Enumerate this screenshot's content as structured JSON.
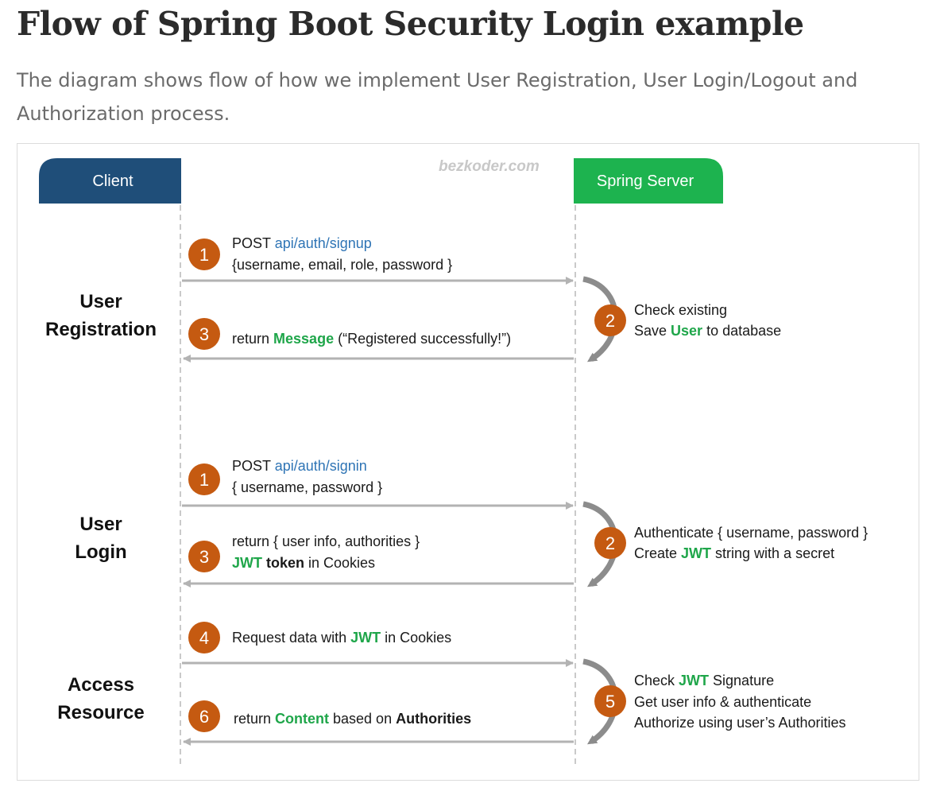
{
  "page": {
    "title": "Flow of Spring Boot Security Login example",
    "description": "The diagram shows flow of how we implement User Registration, User Login/Logout and Authorization process."
  },
  "diagram": {
    "watermark": "bezkoder.com",
    "client_label": "Client",
    "server_label": "Spring Server",
    "colors": {
      "client": "#1f4e79",
      "server": "#1db34f",
      "step": "#c55a11",
      "arrow": "#b3b3b3",
      "link": "#2e74b5",
      "highlight": "#1fa64a"
    },
    "registration": {
      "section": [
        "User",
        "Registration"
      ],
      "step1_num": "1",
      "step1_method": "POST ",
      "step1_path": "api/auth/signup",
      "step1_body": "{username, email, role, password }",
      "step2_num": "2",
      "step2_line1": "Check existing",
      "step2_line2_a": "Save ",
      "step2_line2_b": "User",
      "step2_line2_c": " to database",
      "step3_num": "3",
      "step3_a": "return ",
      "step3_b": "Message",
      "step3_c": " (“Registered successfully!”)"
    },
    "login": {
      "section": [
        "User",
        "Login"
      ],
      "step1_num": "1",
      "step1_method": "POST ",
      "step1_path": "api/auth/signin",
      "step1_body": "{ username, password }",
      "step2_num": "2",
      "step2_line1": "Authenticate { username, password }",
      "step2_line2_a": "Create ",
      "step2_line2_b": "JWT",
      "step2_line2_c": " string with a secret",
      "step3_num": "3",
      "step3_line1": "return { user info, authorities }",
      "step3_line2_a": "JWT",
      "step3_line2_b": " token",
      "step3_line2_c": " in Cookies"
    },
    "access": {
      "section": [
        "Access",
        "Resource"
      ],
      "step4_num": "4",
      "step4_a": "Request data with ",
      "step4_b": "JWT",
      "step4_c": " in Cookies",
      "step5_num": "5",
      "step5_line1_a": "Check ",
      "step5_line1_b": "JWT",
      "step5_line1_c": " Signature",
      "step5_line2": "Get user info & authenticate",
      "step5_line3": "Authorize using user’s Authorities",
      "step6_num": "6",
      "step6_a": "return ",
      "step6_b": "Content",
      "step6_c": " based on ",
      "step6_d": "Authorities"
    }
  }
}
